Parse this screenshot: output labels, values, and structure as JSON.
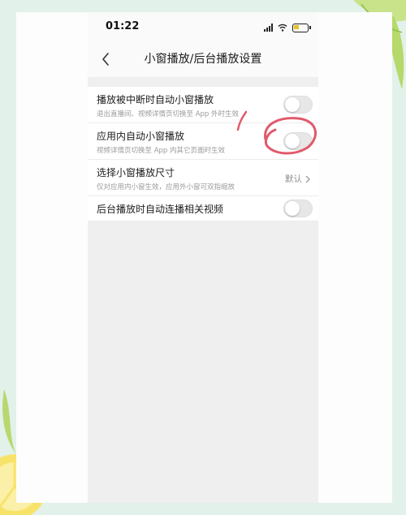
{
  "status_bar": {
    "time": "01:22"
  },
  "nav": {
    "title": "小窗播放/后台播放设置"
  },
  "settings": [
    {
      "title": "播放被中断时自动小窗播放",
      "subtitle": "退出直播间、视频详情页切换至 App 外时生效",
      "control": "toggle",
      "on": false
    },
    {
      "title": "应用内自动小窗播放",
      "subtitle": "视频详情页切换至 App 内其它页面时生效",
      "control": "toggle",
      "on": false
    },
    {
      "title": "选择小窗播放尺寸",
      "subtitle": "仅对应用内小窗生效，应用外小窗可双指缩放",
      "control": "value",
      "value": "默认"
    },
    {
      "title": "后台播放时自动连播相关视频",
      "control": "toggle",
      "on": false
    }
  ],
  "colors": {
    "annotation": "#e05a6a",
    "toggle_off": "#e7e7e7",
    "background": "#e2f1ea"
  }
}
